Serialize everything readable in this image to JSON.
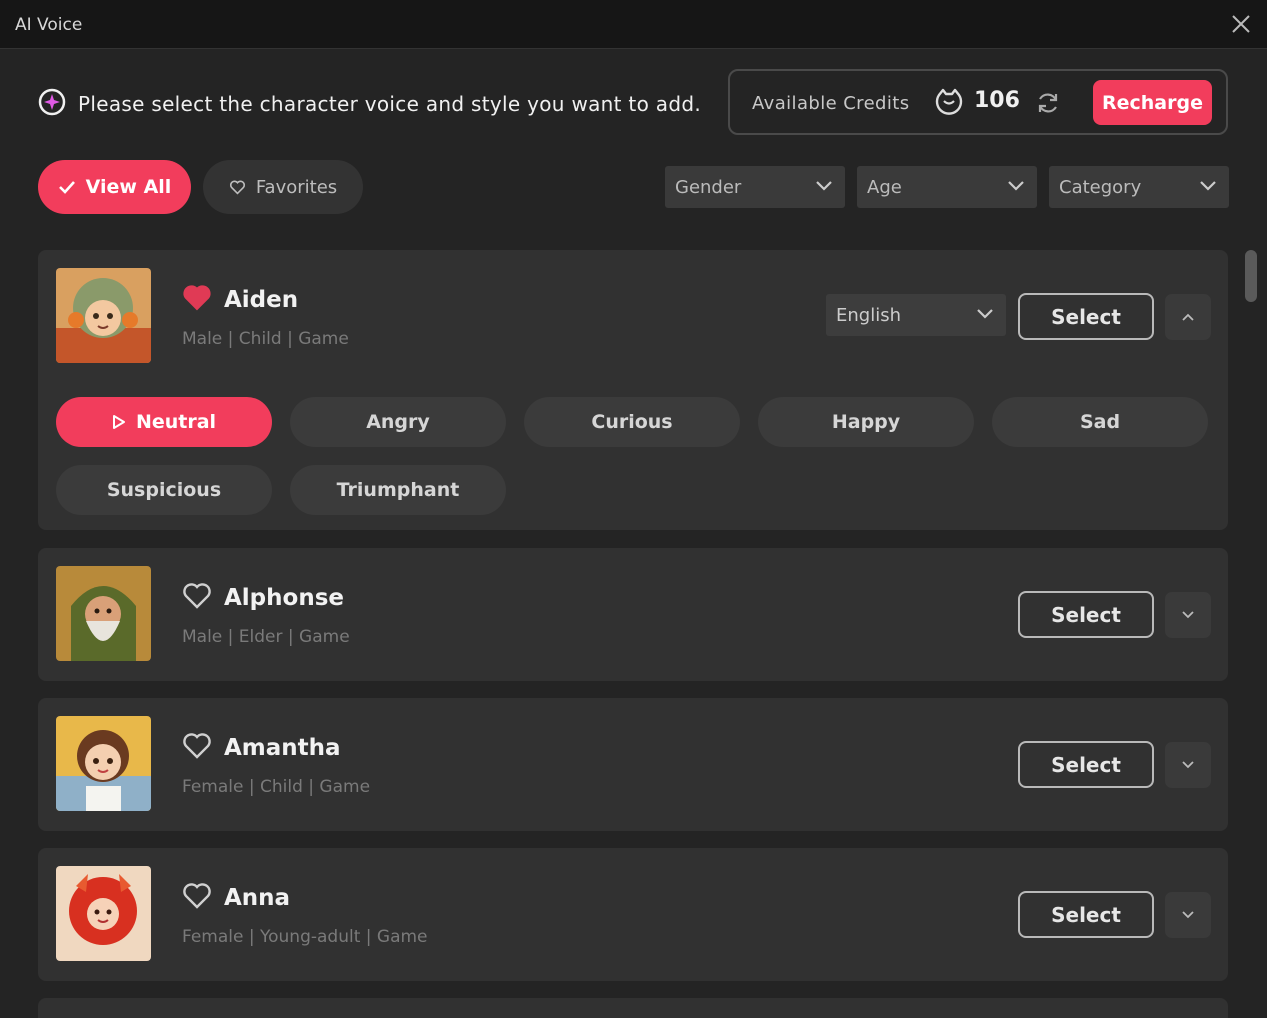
{
  "window": {
    "title": "AI Voice"
  },
  "header": {
    "prompt": "Please select the character voice and style you want to add.",
    "credits_label": "Available Credits",
    "credits_value": "106",
    "recharge_label": "Recharge"
  },
  "tabs": {
    "view_all": "View All",
    "favorites": "Favorites"
  },
  "filters": {
    "gender": "Gender",
    "age": "Age",
    "category": "Category"
  },
  "voices": [
    {
      "name": "Aiden",
      "tags": "Male | Child | Game",
      "favorite": true,
      "expanded": true,
      "language": "English",
      "select_label": "Select",
      "styles": [
        "Neutral",
        "Angry",
        "Curious",
        "Happy",
        "Sad",
        "Suspicious",
        "Triumphant"
      ],
      "active_style": "Neutral"
    },
    {
      "name": "Alphonse",
      "tags": "Male | Elder | Game",
      "favorite": false,
      "expanded": false,
      "select_label": "Select"
    },
    {
      "name": "Amantha",
      "tags": "Female | Child | Game",
      "favorite": false,
      "expanded": false,
      "select_label": "Select"
    },
    {
      "name": "Anna",
      "tags": "Female | Young-adult | Game",
      "favorite": false,
      "expanded": false,
      "select_label": "Select"
    }
  ],
  "colors": {
    "accent": "#f23d5c",
    "background": "#242424",
    "card": "#313131",
    "titlebar": "#161616"
  },
  "icons": {
    "close": "close-icon",
    "sparkle": "voice-sparkle-icon",
    "coin": "credit-coin-icon",
    "refresh": "refresh-icon",
    "heart": "heart-icon",
    "check": "check-icon",
    "play": "play-icon",
    "chevron": "chevron-down-icon"
  }
}
